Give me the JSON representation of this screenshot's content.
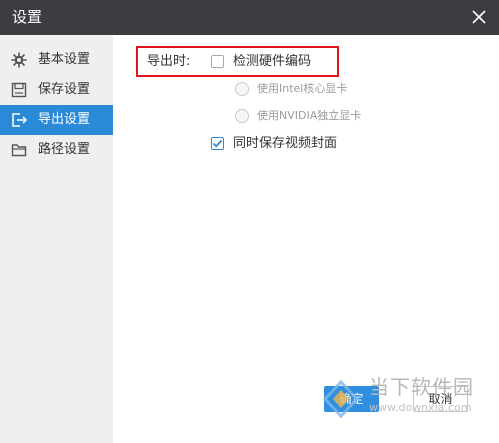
{
  "window": {
    "title": "设置"
  },
  "sidebar": {
    "items": [
      {
        "label": "基本设置",
        "icon": "gear-icon",
        "active": false
      },
      {
        "label": "保存设置",
        "icon": "save-icon",
        "active": false
      },
      {
        "label": "导出设置",
        "icon": "export-icon",
        "active": true
      },
      {
        "label": "路径设置",
        "icon": "folder-icon",
        "active": false
      }
    ]
  },
  "export": {
    "label": "导出时:",
    "hardware_encoding": {
      "label": "检测硬件编码",
      "checked": false
    },
    "intel_option": {
      "label": "使用Intel核心显卡",
      "selected": false,
      "disabled": true
    },
    "nvidia_option": {
      "label": "使用NVIDIA独立显卡",
      "selected": false,
      "disabled": true
    },
    "save_cover": {
      "label": "同时保存视频封面",
      "checked": true
    }
  },
  "buttons": {
    "ok": "确定",
    "cancel": "取消"
  },
  "watermark": {
    "name": "当下软件园",
    "url": "www.downxia.com"
  },
  "colors": {
    "titlebar": "#3b3d41",
    "accent": "#2b8ad8",
    "highlight": "#e0141e",
    "sidebar_bg": "#efefef"
  }
}
